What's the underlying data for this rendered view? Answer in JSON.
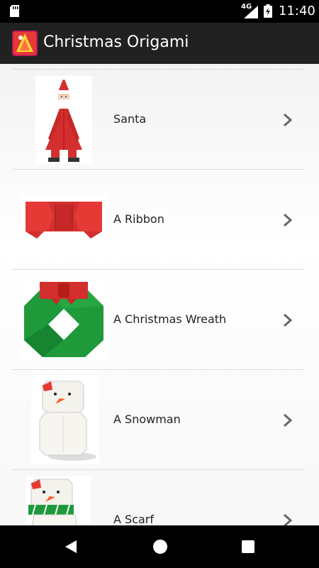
{
  "status_bar": {
    "network": "4G",
    "time": "11:40",
    "icons": [
      "sd-card-icon",
      "signal-icon",
      "battery-icon"
    ]
  },
  "app_bar": {
    "title": "Christmas Origami",
    "icon": "app-icon"
  },
  "list": {
    "items": [
      {
        "label": "Santa",
        "icon": "santa-origami-image"
      },
      {
        "label": "A Ribbon",
        "icon": "ribbon-origami-image"
      },
      {
        "label": "A Christmas Wreath",
        "icon": "wreath-origami-image"
      },
      {
        "label": "A Snowman",
        "icon": "snowman-origami-image"
      },
      {
        "label": "A Scarf",
        "icon": "scarf-origami-image"
      }
    ]
  },
  "nav_bar": {
    "buttons": [
      "back-icon",
      "home-icon",
      "recents-icon"
    ]
  },
  "colors": {
    "status_bar": "#000000",
    "app_bar": "#212121",
    "list_bg": "#f2f2f2",
    "divider": "#dcdcdc",
    "chevron": "#666666",
    "origami_red": "#d32f2f",
    "origami_green": "#1e9a3a"
  }
}
